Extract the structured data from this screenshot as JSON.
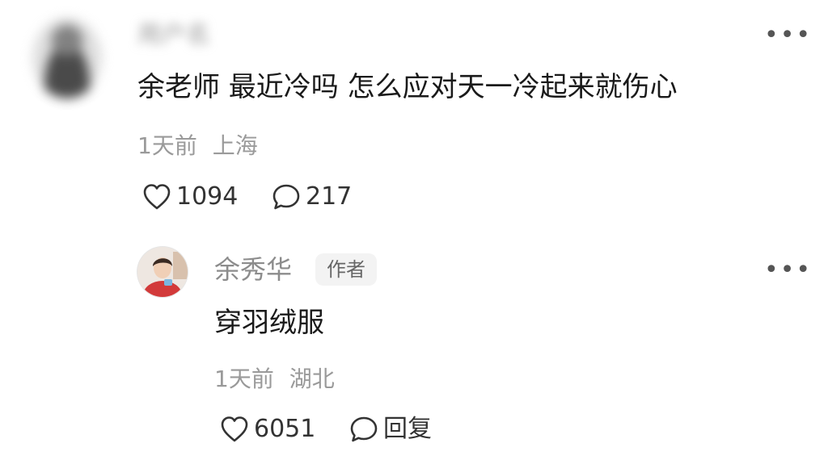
{
  "top_comment": {
    "username": "用户名",
    "text": "余老师 最近冷吗 怎么应对天一冷起来就伤心",
    "time": "1天前",
    "location": "上海",
    "likes": "1094",
    "replies": "217",
    "more_icon": "more-dots-icon"
  },
  "reply": {
    "author": "余秀华",
    "badge": "作者",
    "text": "穿羽绒服",
    "time": "1天前",
    "location": "湖北",
    "likes": "6051",
    "reply_label": "回复",
    "more_icon": "more-dots-icon"
  },
  "colors": {
    "text": "#1a1a1a",
    "meta": "#9a9a9a",
    "icon": "#333333",
    "badge_bg": "#f3f3f3"
  }
}
